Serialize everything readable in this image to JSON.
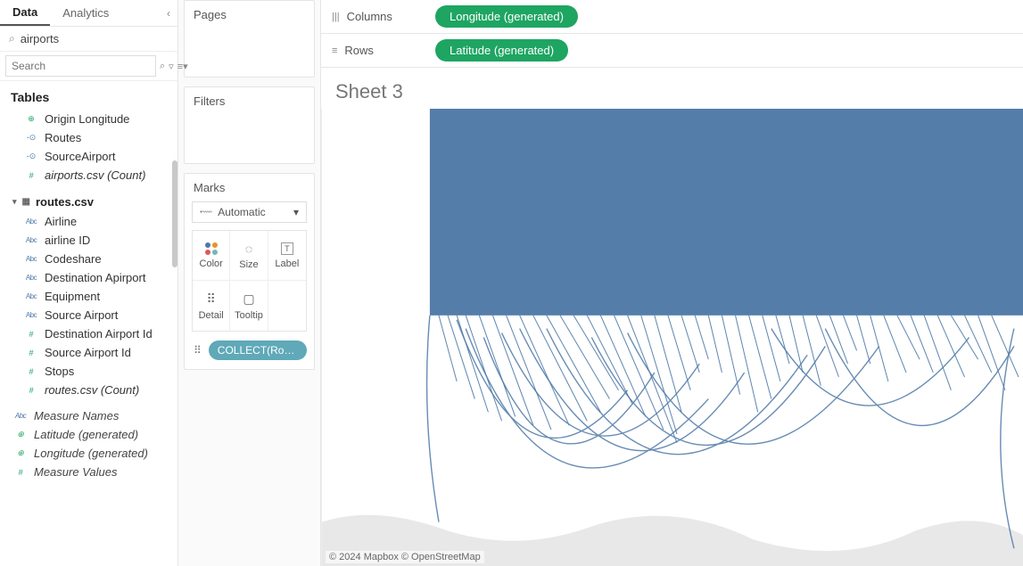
{
  "tabs": {
    "data": "Data",
    "analytics": "Analytics"
  },
  "datasource": {
    "name": "airports"
  },
  "search": {
    "placeholder": "Search"
  },
  "tables_header": "Tables",
  "fields_top": [
    {
      "icon": "geo",
      "label": "Origin Longitude"
    },
    {
      "icon": "line",
      "label": "Routes"
    },
    {
      "icon": "line",
      "label": "SourceAirport"
    },
    {
      "icon": "num",
      "label": "airports.csv (Count)",
      "italic": true
    }
  ],
  "table_group": {
    "name": "routes.csv"
  },
  "fields_routes": [
    {
      "icon": "abc",
      "label": "Airline"
    },
    {
      "icon": "abc",
      "label": "airline ID"
    },
    {
      "icon": "abc",
      "label": "Codeshare"
    },
    {
      "icon": "abc",
      "label": "Destination Apirport"
    },
    {
      "icon": "abc",
      "label": "Equipment"
    },
    {
      "icon": "abc",
      "label": "Source Airport"
    },
    {
      "icon": "num",
      "label": "Destination Airport Id"
    },
    {
      "icon": "num",
      "label": "Source Airport Id"
    },
    {
      "icon": "num",
      "label": "Stops"
    },
    {
      "icon": "num",
      "label": "routes.csv (Count)",
      "italic": true
    }
  ],
  "generated": {
    "measure_names": "Measure Names",
    "latitude": "Latitude (generated)",
    "longitude": "Longitude (generated)",
    "measure_values": "Measure Values"
  },
  "cards": {
    "pages": "Pages",
    "filters": "Filters",
    "marks": "Marks"
  },
  "marks": {
    "type": "Automatic",
    "btn_color": "Color",
    "btn_size": "Size",
    "btn_label": "Label",
    "btn_detail": "Detail",
    "btn_tooltip": "Tooltip",
    "pill": "COLLECT(Rout..."
  },
  "shelves": {
    "columns_label": "Columns",
    "rows_label": "Rows",
    "columns_pill": "Longitude (generated)",
    "rows_pill": "Latitude (generated)"
  },
  "sheet_title": "Sheet 3",
  "attribution": "© 2024 Mapbox © OpenStreetMap",
  "colors": {
    "route": "#4e79a7",
    "pill_green": "#1ea562",
    "pill_teal": "#5fa9b8"
  }
}
